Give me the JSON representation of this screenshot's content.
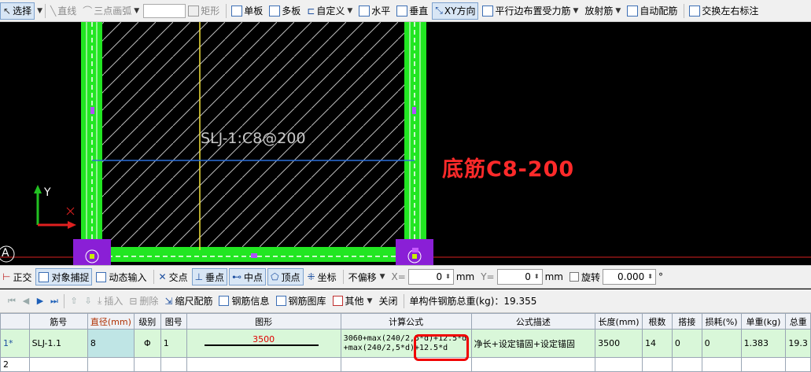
{
  "toolbar": {
    "items": [
      {
        "label": "选择",
        "icon": "pointer-icon",
        "active": true,
        "dropdown": true
      },
      {
        "label": "直线",
        "icon": "line-icon",
        "disabled": true
      },
      {
        "label": "三点画弧",
        "icon": "arc-icon",
        "disabled": true,
        "dropdown": true
      },
      {
        "label": "矩形",
        "icon": "rectangle-icon",
        "disabled": true
      },
      {
        "label": "单板",
        "icon": "single-slab-icon"
      },
      {
        "label": "多板",
        "icon": "multi-slab-icon"
      },
      {
        "label": "自定义",
        "icon": "custom-icon",
        "dropdown": true
      },
      {
        "label": "水平",
        "icon": "horizontal-icon"
      },
      {
        "label": "垂直",
        "icon": "vertical-icon"
      },
      {
        "label": "XY方向",
        "icon": "xy-direction-icon",
        "active": true
      },
      {
        "label": "平行边布置受力筋",
        "icon": "parallel-edge-icon",
        "dropdown": true
      },
      {
        "label": "放射筋",
        "dropdown": true
      },
      {
        "label": "自动配筋",
        "icon": "auto-rebar-icon"
      },
      {
        "label": "交换左右标注",
        "icon": "swap-icon"
      }
    ]
  },
  "canvas": {
    "label_rebar": "SLJ-1:C8@200",
    "callout": "底筋C8-200",
    "axis_y": "Y",
    "axis_x": "X",
    "grid_label": "A",
    "colors": {
      "slab_border": "#22e622",
      "corner": "#8a1fd6",
      "label": "#c8c8c8",
      "callout": "#ff2a2a",
      "rebar_line": "#2a6fdb",
      "yellow_line": "#f3e23a"
    }
  },
  "snapbar": {
    "ortho": "正交",
    "osnap": "对象捕捉",
    "dyninput": "动态输入",
    "intersect": "交点",
    "perp": "垂点",
    "mid": "中点",
    "vertex": "顶点",
    "coord": "坐标",
    "offset_mode": "不偏移",
    "x_label": "X=",
    "x_value": "0",
    "mm1": "mm",
    "y_label": "Y=",
    "y_value": "0",
    "mm2": "mm",
    "rotate_label": "旋转",
    "rotate_value": "0.000",
    "degree": "°"
  },
  "editor": {
    "insert": "插入",
    "delete": "删除",
    "scale": "缩尺配筋",
    "info": "钢筋信息",
    "library": "钢筋图库",
    "other": "其他",
    "close": "关闭",
    "total_weight": "单构件钢筋总重(kg)：19.355"
  },
  "table": {
    "headers": [
      "",
      "筋号",
      "直径(mm)",
      "级别",
      "图号",
      "图形",
      "计算公式",
      "公式描述",
      "长度(mm)",
      "根数",
      "搭接",
      "损耗(%)",
      "单重(kg)",
      "总重"
    ],
    "rows": [
      {
        "row": "1*",
        "bar_no": "SLJ-1.1",
        "diameter": "8",
        "grade": "Φ",
        "fig": "1",
        "shape_value": "3500",
        "formula_line1": "3060+max(240/2,5*d)+12.5*d",
        "formula_line2": "+max(240/2,5*d)+12.5*d",
        "desc": "净长+设定锚固+设定锚固",
        "length": "3500",
        "count": "14",
        "lap": "0",
        "loss": "0",
        "unit_weight": "1.383",
        "total": "19.3"
      },
      {
        "row": "2"
      }
    ]
  }
}
